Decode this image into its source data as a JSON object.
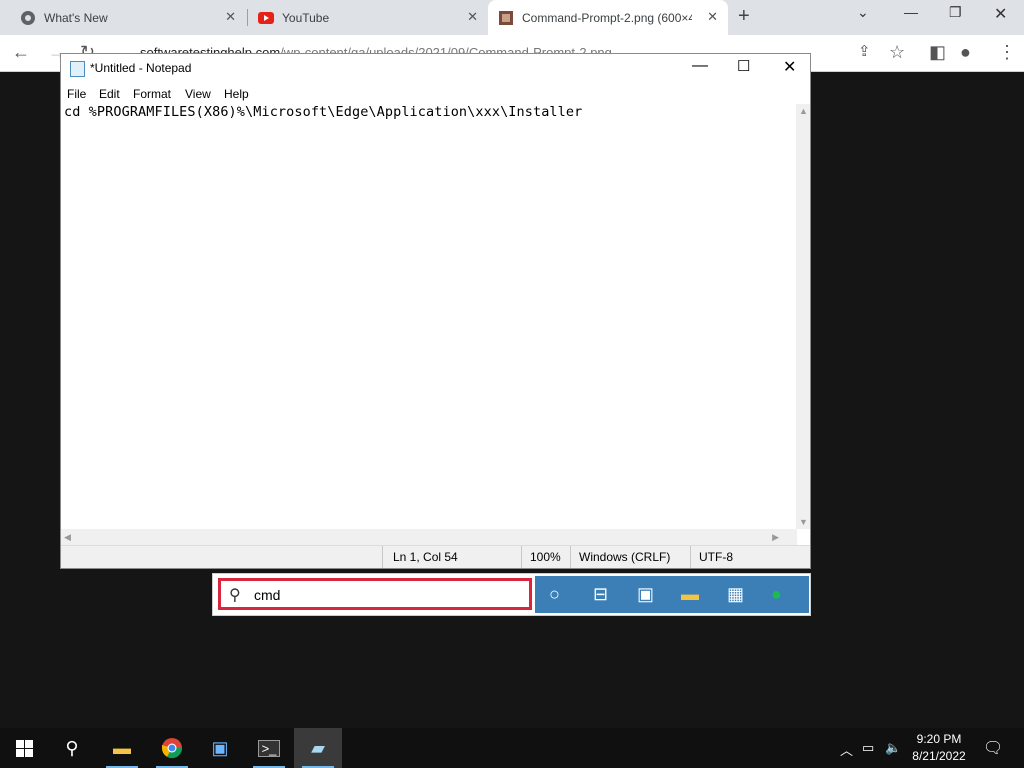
{
  "browser": {
    "tabs": [
      {
        "title": "What's New",
        "icon": "chrome-icon"
      },
      {
        "title": "YouTube",
        "icon": "youtube-icon"
      },
      {
        "title": "Command-Prompt-2.png (600×4",
        "icon": "image-icon"
      }
    ],
    "url": {
      "host": "softwaretestinghelp.com",
      "path": "/wp-content/qa/uploads/2021/09/Command-Prompt-2.png"
    }
  },
  "notepad": {
    "title": "*Untitled - Notepad",
    "menu": [
      "File",
      "Edit",
      "Format",
      "View",
      "Help"
    ],
    "content": "cd %PROGRAMFILES(X86)%\\Microsoft\\Edge\\Application\\xxx\\Installer",
    "status": {
      "position": "Ln 1, Col 54",
      "zoom": "100%",
      "line_ending": "Windows (CRLF)",
      "encoding": "UTF-8"
    }
  },
  "search": {
    "query": "cmd"
  },
  "taskbar": {
    "time": "9:20 PM",
    "date": "8/21/2022"
  },
  "colors": {
    "search_highlight": "#d7263d",
    "search_icons_bg": "#3b7fb6",
    "taskbar_bg": "#101010"
  }
}
